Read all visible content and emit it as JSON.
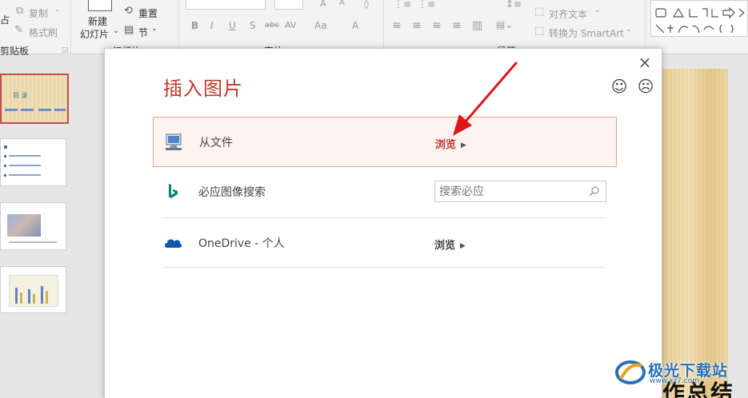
{
  "ribbon": {
    "clipboard": {
      "paste_partial": "占",
      "copy_label": "复制",
      "format_painter_label": "格式刷",
      "group_label": "剪贴板"
    },
    "slides": {
      "new_slide_label_line1": "新建",
      "new_slide_label_line2": "幻灯片",
      "reset_label": "重置",
      "section_label": "节",
      "group_label": "幻灯片"
    },
    "font": {
      "bold": "B",
      "italic": "I",
      "underline": "U",
      "shadow": "S",
      "strike": "abc",
      "spacing": "AV",
      "case": "Aa",
      "color": "A",
      "group_label": "字体"
    },
    "paragraph": {
      "align_text_label": "对齐文本",
      "convert_smartart_label": "转换为 SmartArt",
      "group_label": "段落"
    }
  },
  "dialog": {
    "title": "插入图片",
    "close_glyph": "×",
    "smile_glyph": "☺",
    "frown_glyph": "☹",
    "rows": [
      {
        "label": "从文件",
        "action": "浏览"
      },
      {
        "label": "必应图像搜索",
        "placeholder": "搜索必应"
      },
      {
        "label": "OneDrive - 个人",
        "action": "浏览"
      }
    ]
  },
  "slide": {
    "bottom_text": "作总结"
  },
  "thumbnails": {
    "slide1_title": "目  录"
  },
  "watermark": {
    "name": "极光下载站",
    "url": "www.xz7.com"
  },
  "colors": {
    "accent": "#c0392b",
    "highlight_border": "#e4a592",
    "highlight_bg": "#fdf3ef",
    "bing": "#008373",
    "onedrive": "#0f5aa8"
  }
}
